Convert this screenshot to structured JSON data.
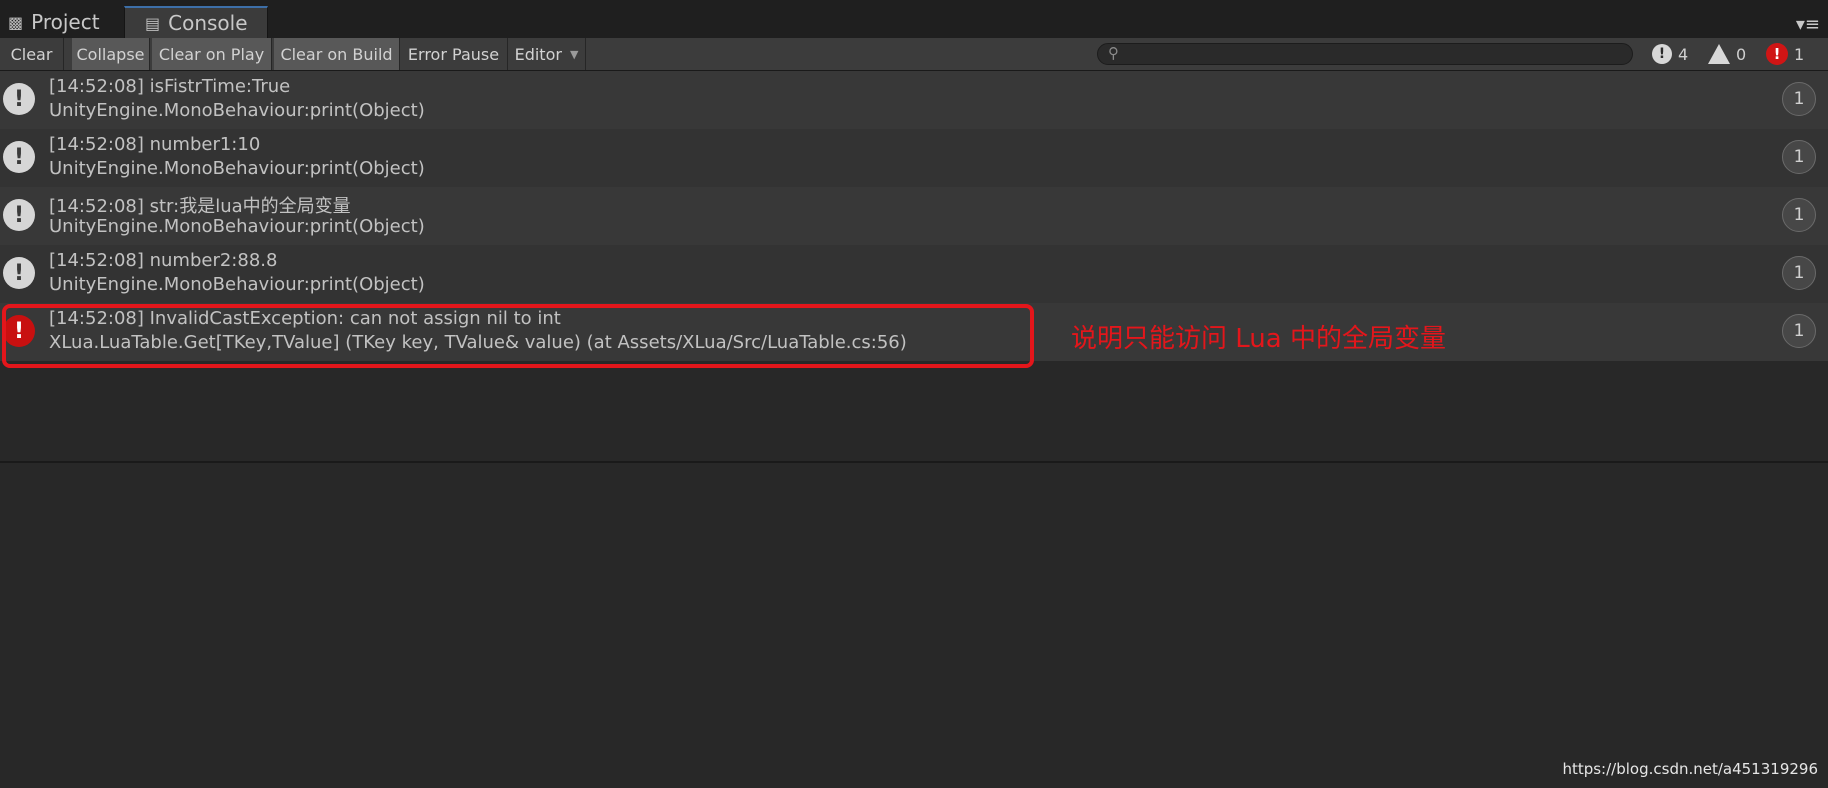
{
  "tabs": [
    {
      "label": "Project",
      "icon": "folder-icon"
    },
    {
      "label": "Console",
      "icon": "console-icon",
      "active": true
    }
  ],
  "toolbar": {
    "buttons": [
      {
        "label": "Clear",
        "on": false
      },
      {
        "label": "Collapse",
        "on": true
      },
      {
        "label": "Clear on Play",
        "on": true
      },
      {
        "label": "Clear on Build",
        "on": true
      },
      {
        "label": "Error Pause",
        "on": false
      },
      {
        "label": "Editor",
        "on": false,
        "dropdown": true
      }
    ],
    "search": {
      "value": "",
      "placeholder": ""
    },
    "counts": {
      "info": "4",
      "warning": "0",
      "error": "1"
    }
  },
  "logs": [
    {
      "type": "info",
      "line1": "[14:52:08] isFistrTime:True",
      "line2": "UnityEngine.MonoBehaviour:print(Object)",
      "count": "1"
    },
    {
      "type": "info",
      "line1": "[14:52:08] number1:10",
      "line2": "UnityEngine.MonoBehaviour:print(Object)",
      "count": "1"
    },
    {
      "type": "info",
      "line1": "[14:52:08] str:我是lua中的全局变量",
      "line2": "UnityEngine.MonoBehaviour:print(Object)",
      "count": "1"
    },
    {
      "type": "info",
      "line1": "[14:52:08] number2:88.8",
      "line2": "UnityEngine.MonoBehaviour:print(Object)",
      "count": "1"
    },
    {
      "type": "error",
      "line1": "[14:52:08] InvalidCastException: can not assign nil to int",
      "line2": "XLua.LuaTable.Get[TKey,TValue] (TKey key, TValue& value) (at Assets/XLua/Src/LuaTable.cs:56)",
      "count": "1"
    }
  ],
  "annotation": "说明只能访问 Lua 中的全局变量",
  "watermark": "https://blog.csdn.net/a451319296",
  "colors": {
    "accent": "#3d6fa8",
    "error": "#c81010",
    "annotation": "#e3161b"
  }
}
